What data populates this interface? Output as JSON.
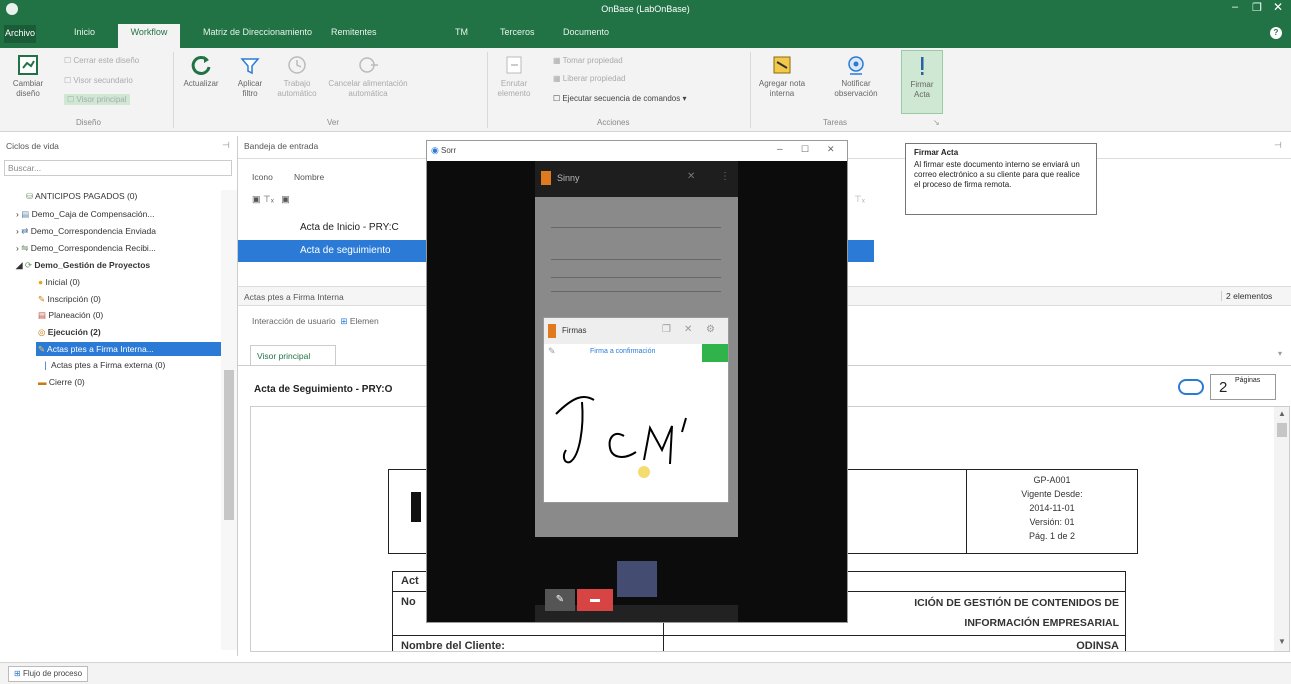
{
  "window": {
    "title": "OnBase (LabOnBase)"
  },
  "menu": {
    "archivo": "Archivo",
    "inicio": "Inicio",
    "workflow": "Workflow",
    "matriz": "Matriz de Direccionamiento",
    "remitentes": "Remitentes",
    "tm": "TM",
    "terceros": "Terceros",
    "documento": "Documento"
  },
  "ribbon": {
    "cambiar_diseno": "Cambiar diseño",
    "cerrar_diseno": "Cerrar este diseño",
    "visor_secundario": "Visor secundario",
    "visor_principal": "Visor principal",
    "grp_diseno": "Diseño",
    "actualizar": "Actualizar",
    "aplicar_filtro": "Aplicar filtro",
    "trabajo_automatico": "Trabajo automático",
    "cancelar_alimentacion": "Cancelar alimentación automática",
    "grp_ver": "Ver",
    "enrutar_elemento": "Enrutar elemento",
    "tomar_propiedad": "Tomar propiedad",
    "liberar_propiedad": "Liberar propiedad",
    "ejecutar_secuencia": "Ejecutar secuencia de comandos",
    "grp_acciones": "Acciones",
    "agregar_nota": "Agregar nota interna",
    "notificar_observacion": "Notificar observación",
    "firmar_acta": "Firmar Acta",
    "grp_tareas": "Tareas"
  },
  "left_panel": {
    "title": "Ciclos de vida",
    "search_placeholder": "Buscar...",
    "items": [
      {
        "label": "ANTICIPOS PAGADOS (0)"
      },
      {
        "label": "Demo_Caja de Compensación..."
      },
      {
        "label": "Demo_Correspondencia Enviada"
      },
      {
        "label": "Demo_Correspondencia Recibi..."
      },
      {
        "label": "Demo_Gestión de Proyectos"
      },
      {
        "label": "Inicial (0)"
      },
      {
        "label": "Inscripción (0)"
      },
      {
        "label": "Planeación (0)"
      },
      {
        "label": "Ejecución (2)"
      },
      {
        "label": "Actas ptes a Firma Interna..."
      },
      {
        "label": "Actas ptes a Firma externa (0)"
      },
      {
        "label": "Cierre (0)"
      }
    ]
  },
  "inbox": {
    "title": "Bandeja de entrada",
    "col_icono": "Icono",
    "col_nombre": "Nombre",
    "rows": [
      "Acta de Inicio - PRY:C",
      "Acta de seguimiento"
    ]
  },
  "queue": {
    "title": "Actas ptes a Firma Interna",
    "count": "2 elementos",
    "interaction": "Interacción de usuario",
    "elem": "Elemen"
  },
  "viewer": {
    "tab": "Visor principal",
    "doc_title": "Acta de Seguimiento - PRY:O",
    "pages_num": "2",
    "pages_label": "Páginas"
  },
  "document": {
    "code": "GP-A001",
    "vigente": "Vigente Desde:",
    "fecha": "2014-11-01",
    "version": "Versión: 01",
    "pag": "Pág. 1 de 2",
    "cell_act": "Act",
    "cell_no": "No",
    "solucion_1": "ICIÓN DE GESTIÓN DE CONTENIDOS DE",
    "solucion_2": "INFORMACIÓN EMPRESARIAL",
    "cliente_label": "Nombre del Cliente:",
    "cliente": "ODINSA"
  },
  "dialog": {
    "title": "Sorr",
    "app_title": "Sinny",
    "firma_title": "Firmas",
    "firma_sub": "Firma a confirmación"
  },
  "tooltip": {
    "title": "Firmar Acta",
    "body": "Al firmar este documento interno se enviará un correo electrónico a su cliente para que realice el proceso de firma remota."
  },
  "status": {
    "flujo": "Flujo de proceso"
  },
  "colors": {
    "brand": "#217346",
    "selection": "#2b7bd6",
    "highlight": "#0078d7"
  }
}
